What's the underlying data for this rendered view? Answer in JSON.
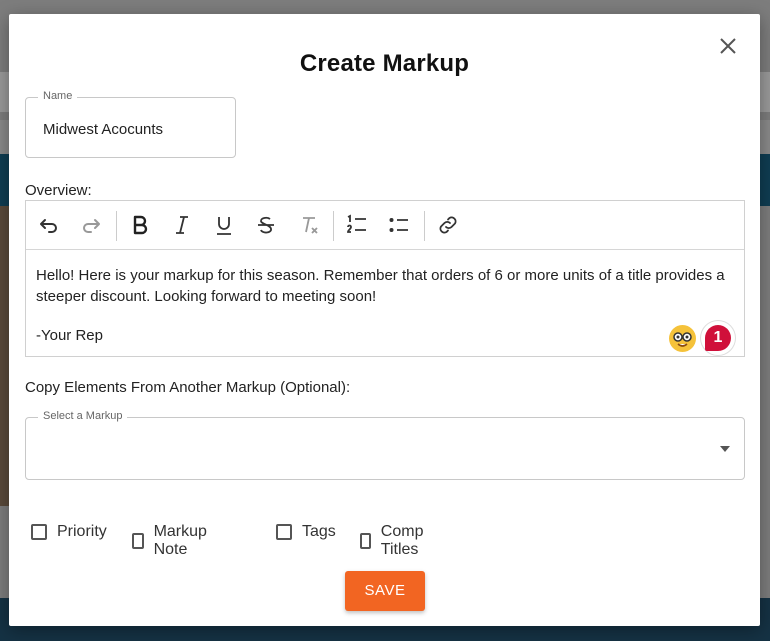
{
  "modal": {
    "title": "Create Markup",
    "name_field": {
      "label": "Name",
      "value": "Midwest Acocunts"
    },
    "overview_label": "Overview:",
    "editor": {
      "toolbar": [
        "undo-icon",
        "redo-icon",
        "bold-icon",
        "italic-icon",
        "underline-icon",
        "strikethrough-icon",
        "clear-format-icon",
        "ordered-list-icon",
        "bullet-list-icon",
        "link-icon"
      ],
      "body_line1": "Hello! Here is your markup for this season. Remember that orders of 6 or more units of a title provides a steeper discount. Looking forward to meeting soon!",
      "body_signature": "-Your Rep",
      "badge_count": "1"
    },
    "copy_label": "Copy Elements From Another Markup (Optional):",
    "select_field": {
      "label": "Select a Markup",
      "value": ""
    },
    "checkboxes": [
      {
        "label": "Priority",
        "checked": false
      },
      {
        "label": "Markup Note",
        "checked": false
      },
      {
        "label": "Tags",
        "checked": false
      },
      {
        "label": "Comp Titles",
        "checked": false
      }
    ],
    "save_label": "SAVE"
  },
  "colors": {
    "accent": "#f26522",
    "overlay": "#7d7d7d",
    "badge": "#d0103a"
  }
}
